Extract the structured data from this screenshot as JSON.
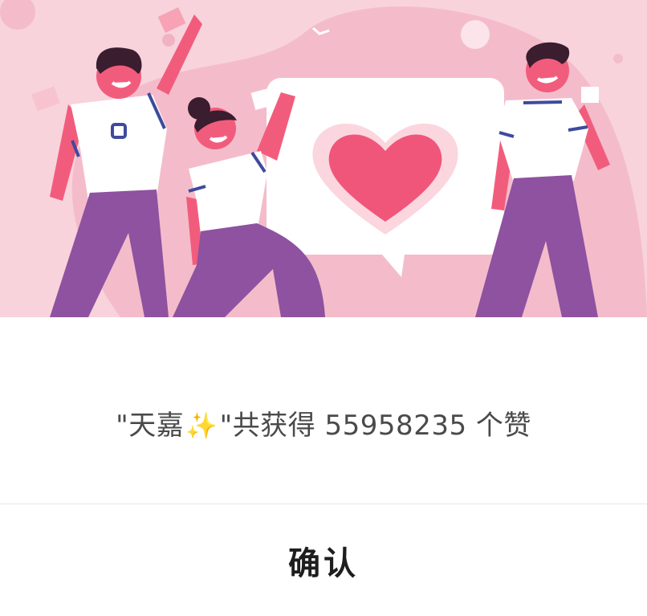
{
  "dialog": {
    "message": {
      "quote_open": "\"",
      "nickname": "天嘉",
      "sparkle": "✨",
      "quote_close": "\"",
      "prefix": "共获得",
      "likes_count": "55958235",
      "suffix": "个赞"
    },
    "confirm_label": "确认"
  },
  "illustration": {
    "icon": "heart-icon",
    "colors": {
      "background": "#f8d3dc",
      "skin": "#f25c7c",
      "pants": "#8e52a0",
      "heart": "#f0567a"
    }
  }
}
